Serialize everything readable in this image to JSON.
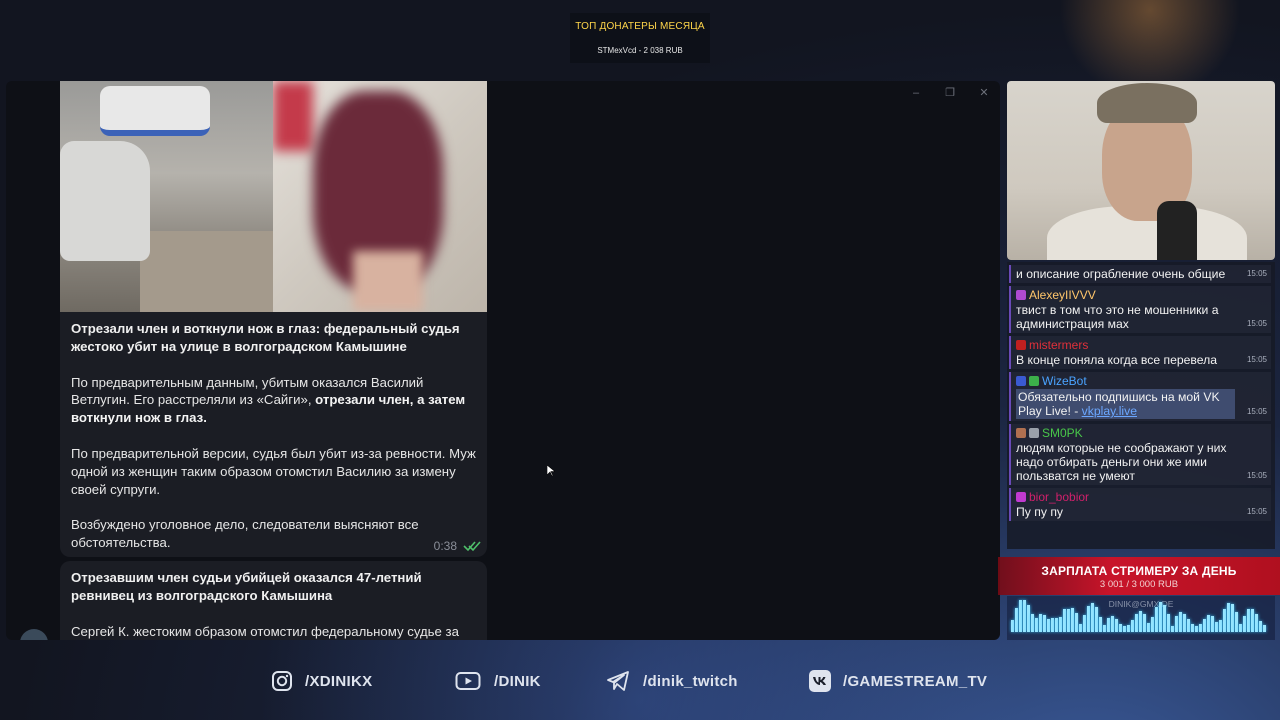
{
  "donators": {
    "title": "ТОП ДОНАТЕРЫ МЕСЯЦА",
    "entry": "STMexVcd - 2 038 RUB"
  },
  "telegram": {
    "message1": {
      "headline": "Отрезали член и воткнули нож в глаз: федеральный судья жестоко убит на улице в волгоградском Камышине",
      "p1_a": "По предварительным данным, убитым оказался Василий Ветлугин. Его расстреляли из «Сайги», ",
      "p1_b": "отрезали член, а затем воткнули нож в глаз.",
      "p2": "По предварительной версии, судья был убит из-за ревности. Муж одной из женщин таким образом отомстил Василию за измену своей супруги.",
      "p3": "Возбуждено уголовное дело, следователи выясняют все обстоятельства.",
      "time": "0:38"
    },
    "message2": {
      "headline": "Отрезавшим член судьи убийцей оказался 47-летний ревнивец из волгоградского Камышина",
      "p1": "Сергей К. жестоким образом отомстил федеральному судье за"
    }
  },
  "chat": [
    {
      "user": "",
      "text": "и описание ограбление очень общие",
      "time": "15:05",
      "color": "#ffffff"
    },
    {
      "user": "AlexeyIIVVV",
      "text": "твист в том что это не мошенники а администрация мах",
      "time": "15:05",
      "color": "#ffc66b"
    },
    {
      "user": "mistermers",
      "text": "В конце поняла когда все перевела",
      "time": "15:05",
      "color": "#e0303a"
    },
    {
      "user": "WizeBot",
      "text": "Обязательно подпишись на мой VK Play Live! - ",
      "link": "vkplay.live",
      "time": "15:05",
      "color": "#4aa3ff"
    },
    {
      "user": "SM0PK",
      "text": "людям которые не соображают у них надо отбирать деньги они же ими пользватся не умеют",
      "time": "15:05",
      "color": "#48c74a"
    },
    {
      "user": "bior_bobior",
      "text": "Пу пу пу",
      "time": "15:05",
      "color": "#d0206a"
    }
  ],
  "salary": {
    "title": "ЗАРПЛАТА СТРИМЕРУ ЗА ДЕНЬ",
    "value": "3 001 / 3 000 RUB"
  },
  "audio": {
    "email": "DINIK@GMX.DE"
  },
  "socials": {
    "instagram": "/XDINIKX",
    "youtube": "/DINIK",
    "telegram": "/dinik_twitch",
    "vk": "/GAMESTREAM_TV"
  }
}
